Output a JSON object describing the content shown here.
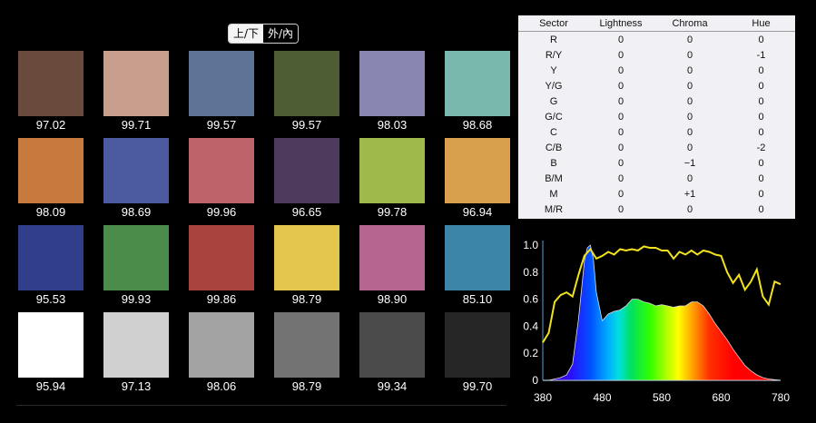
{
  "toggle": {
    "option_a": "上/下",
    "option_b": "外/內",
    "selected": "option_a"
  },
  "swatches": [
    {
      "color": "#6a4a3c",
      "value": "97.02"
    },
    {
      "color": "#c89e8c",
      "value": "99.71"
    },
    {
      "color": "#5e7396",
      "value": "99.57"
    },
    {
      "color": "#4e5d33",
      "value": "99.57"
    },
    {
      "color": "#8986b1",
      "value": "98.03"
    },
    {
      "color": "#79b8ad",
      "value": "98.68"
    },
    {
      "color": "#c87a3e",
      "value": "98.09"
    },
    {
      "color": "#4c5ba0",
      "value": "98.69"
    },
    {
      "color": "#bf636b",
      "value": "99.96"
    },
    {
      "color": "#4e3a5c",
      "value": "96.65"
    },
    {
      "color": "#9fba4a",
      "value": "99.78"
    },
    {
      "color": "#d8a04c",
      "value": "96.94"
    },
    {
      "color": "#313f8a",
      "value": "95.53"
    },
    {
      "color": "#4b8c4a",
      "value": "99.93"
    },
    {
      "color": "#a8433d",
      "value": "99.86"
    },
    {
      "color": "#e4c64e",
      "value": "98.79"
    },
    {
      "color": "#b5658f",
      "value": "98.90"
    },
    {
      "color": "#3d84a9",
      "value": "85.10"
    },
    {
      "color": "#ffffff",
      "value": "95.94"
    },
    {
      "color": "#d0d0d0",
      "value": "97.13"
    },
    {
      "color": "#a3a3a3",
      "value": "98.06"
    },
    {
      "color": "#737373",
      "value": "98.79"
    },
    {
      "color": "#4b4b4b",
      "value": "99.34"
    },
    {
      "color": "#262626",
      "value": "99.70"
    }
  ],
  "table": {
    "headers": [
      "Sector",
      "Lightness",
      "Chroma",
      "Hue"
    ],
    "rows": [
      [
        "R",
        "0",
        "0",
        "0"
      ],
      [
        "R/Y",
        "0",
        "0",
        "-1"
      ],
      [
        "Y",
        "0",
        "0",
        "0"
      ],
      [
        "Y/G",
        "0",
        "0",
        "0"
      ],
      [
        "G",
        "0",
        "0",
        "0"
      ],
      [
        "G/C",
        "0",
        "0",
        "0"
      ],
      [
        "C",
        "0",
        "0",
        "0"
      ],
      [
        "C/B",
        "0",
        "0",
        "-2"
      ],
      [
        "B",
        "0",
        "−1",
        "0"
      ],
      [
        "B/M",
        "0",
        "0",
        "0"
      ],
      [
        "M",
        "0",
        "+1",
        "0"
      ],
      [
        "M/R",
        "0",
        "0",
        "0"
      ]
    ]
  },
  "chart_data": {
    "type": "line",
    "x_ticks": [
      "380",
      "480",
      "580",
      "680",
      "780"
    ],
    "y_ticks": [
      "0",
      "0.2",
      "0.4",
      "0.6",
      "0.8",
      "1.0"
    ],
    "xlim": [
      380,
      780
    ],
    "ylim": [
      0,
      1.0
    ],
    "series": [
      {
        "color": "#f2e21e",
        "x": [
          380,
          390,
          400,
          410,
          420,
          430,
          440,
          450,
          460,
          470,
          480,
          490,
          500,
          510,
          520,
          530,
          540,
          550,
          560,
          570,
          580,
          590,
          600,
          610,
          620,
          630,
          640,
          650,
          660,
          670,
          680,
          690,
          700,
          710,
          720,
          730,
          740,
          750,
          760,
          770,
          780
        ],
        "y": [
          0.28,
          0.35,
          0.58,
          0.63,
          0.65,
          0.62,
          0.78,
          0.92,
          0.97,
          0.9,
          0.92,
          0.95,
          0.93,
          0.97,
          0.96,
          0.97,
          0.96,
          0.99,
          0.98,
          0.98,
          0.96,
          0.96,
          0.9,
          0.95,
          0.93,
          0.96,
          0.93,
          0.96,
          0.95,
          0.93,
          0.92,
          0.8,
          0.72,
          0.78,
          0.67,
          0.73,
          0.82,
          0.62,
          0.56,
          0.73,
          0.71
        ]
      },
      {
        "fill": "spectrum",
        "x": [
          380,
          390,
          400,
          410,
          420,
          430,
          440,
          450,
          455,
          460,
          465,
          470,
          480,
          490,
          500,
          510,
          520,
          530,
          540,
          550,
          560,
          570,
          580,
          590,
          600,
          610,
          620,
          630,
          640,
          650,
          660,
          670,
          680,
          690,
          700,
          710,
          720,
          730,
          740,
          750,
          760,
          770,
          780
        ],
        "y": [
          0.0,
          0.0,
          0.01,
          0.02,
          0.04,
          0.12,
          0.45,
          0.88,
          0.98,
          1.0,
          0.9,
          0.65,
          0.44,
          0.49,
          0.51,
          0.52,
          0.55,
          0.6,
          0.6,
          0.58,
          0.57,
          0.55,
          0.56,
          0.55,
          0.54,
          0.55,
          0.55,
          0.58,
          0.58,
          0.55,
          0.49,
          0.42,
          0.36,
          0.3,
          0.23,
          0.17,
          0.11,
          0.07,
          0.04,
          0.02,
          0.01,
          0.005,
          0.0
        ]
      }
    ]
  }
}
